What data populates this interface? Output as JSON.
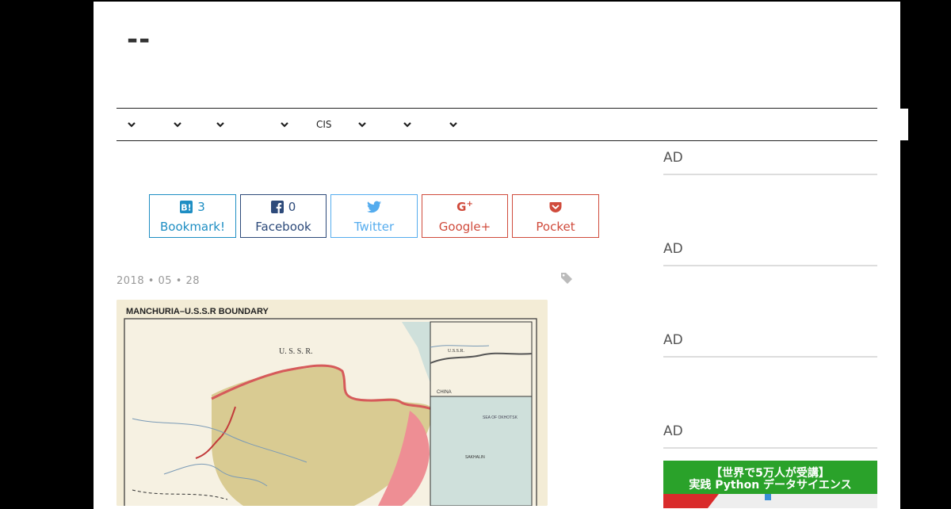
{
  "site": {
    "logo": "--"
  },
  "nav": {
    "items": [
      "",
      "",
      "",
      "",
      "CIS",
      "",
      "",
      ""
    ]
  },
  "share": {
    "hatena": {
      "count": "3",
      "label": "Bookmark!",
      "color": "#1e8ec3"
    },
    "facebook": {
      "count": "0",
      "label": "Facebook",
      "color": "#2d4a7a"
    },
    "twitter": {
      "label": "Twitter",
      "color": "#55acee"
    },
    "googleplus": {
      "label": "Google+",
      "color": "#d04b3c"
    },
    "pocket": {
      "label": "Pocket",
      "color": "#d04b3c"
    }
  },
  "post": {
    "date": "2018 • 05 • 28"
  },
  "map": {
    "title": "MANCHURIA–U.S.S.R BOUNDARY",
    "labels": {
      "ussr": "U. S. S. R.",
      "inset_ussr": "U.S.S.R.",
      "inset_china": "CHINA",
      "sakhalin": "SAKHALIN",
      "sea": "SEA OF OKHOTSK"
    }
  },
  "sidebar": {
    "ads": [
      "AD",
      "AD",
      "AD",
      "AD"
    ]
  },
  "promo": {
    "line1": "【世界で5万人が受講】",
    "line2": "実践 Python データサイエンス"
  }
}
